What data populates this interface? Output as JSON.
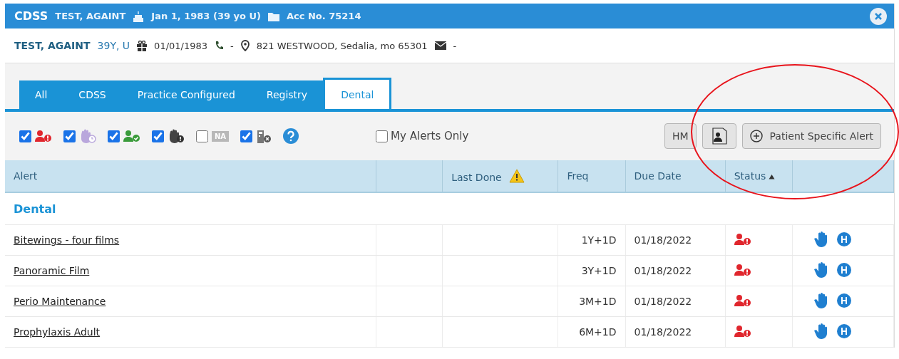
{
  "window": {
    "app": "CDSS",
    "patient": "TEST, AGAINT",
    "dob": "Jan 1, 1983 (39 yo U)",
    "account": "Acc No. 75214"
  },
  "patient_bar": {
    "name": "TEST, AGAINT",
    "age_sex": "39Y, U",
    "birth_date": "01/01/1983",
    "phone": "-",
    "address": "821 WESTWOOD, Sedalia, mo 65301",
    "email": "-"
  },
  "tabs": [
    {
      "label": "All",
      "selected": false
    },
    {
      "label": "CDSS",
      "selected": false
    },
    {
      "label": "Practice Configured",
      "selected": false
    },
    {
      "label": "Registry",
      "selected": false
    },
    {
      "label": "Dental",
      "selected": true
    }
  ],
  "filters": [
    {
      "kind": "overdue",
      "checked": true
    },
    {
      "kind": "pending",
      "checked": true
    },
    {
      "kind": "completed",
      "checked": true
    },
    {
      "kind": "declined",
      "checked": true
    },
    {
      "kind": "na",
      "checked": false,
      "label": "NA"
    },
    {
      "kind": "excluded",
      "checked": true
    }
  ],
  "my_alerts_only": {
    "label": "My Alerts Only",
    "checked": false
  },
  "buttons": {
    "hm": "HM",
    "patient_specific": "Patient Specific Alert"
  },
  "table": {
    "columns": [
      {
        "label": "Alert"
      },
      {},
      {
        "label": "Last Done",
        "warning": true
      },
      {
        "label": "Freq"
      },
      {
        "label": "Due Date"
      },
      {
        "label": "Status",
        "sorted": true
      },
      {}
    ],
    "group": "Dental",
    "rows": [
      {
        "alert": "Bitewings - four films",
        "freq": "1Y+1D",
        "due_date": "01/18/2022",
        "kind": "overdue"
      },
      {
        "alert": "Panoramic Film",
        "freq": "3Y+1D",
        "due_date": "01/18/2022",
        "kind": "overdue"
      },
      {
        "alert": "Perio Maintenance",
        "freq": "3M+1D",
        "due_date": "01/18/2022",
        "kind": "overdue"
      },
      {
        "alert": "Prophylaxis Adult",
        "freq": "6M+1D",
        "due_date": "01/18/2022",
        "kind": "overdue"
      }
    ]
  },
  "annotation": {
    "kind": "ellipse",
    "color": "#e8141c"
  }
}
